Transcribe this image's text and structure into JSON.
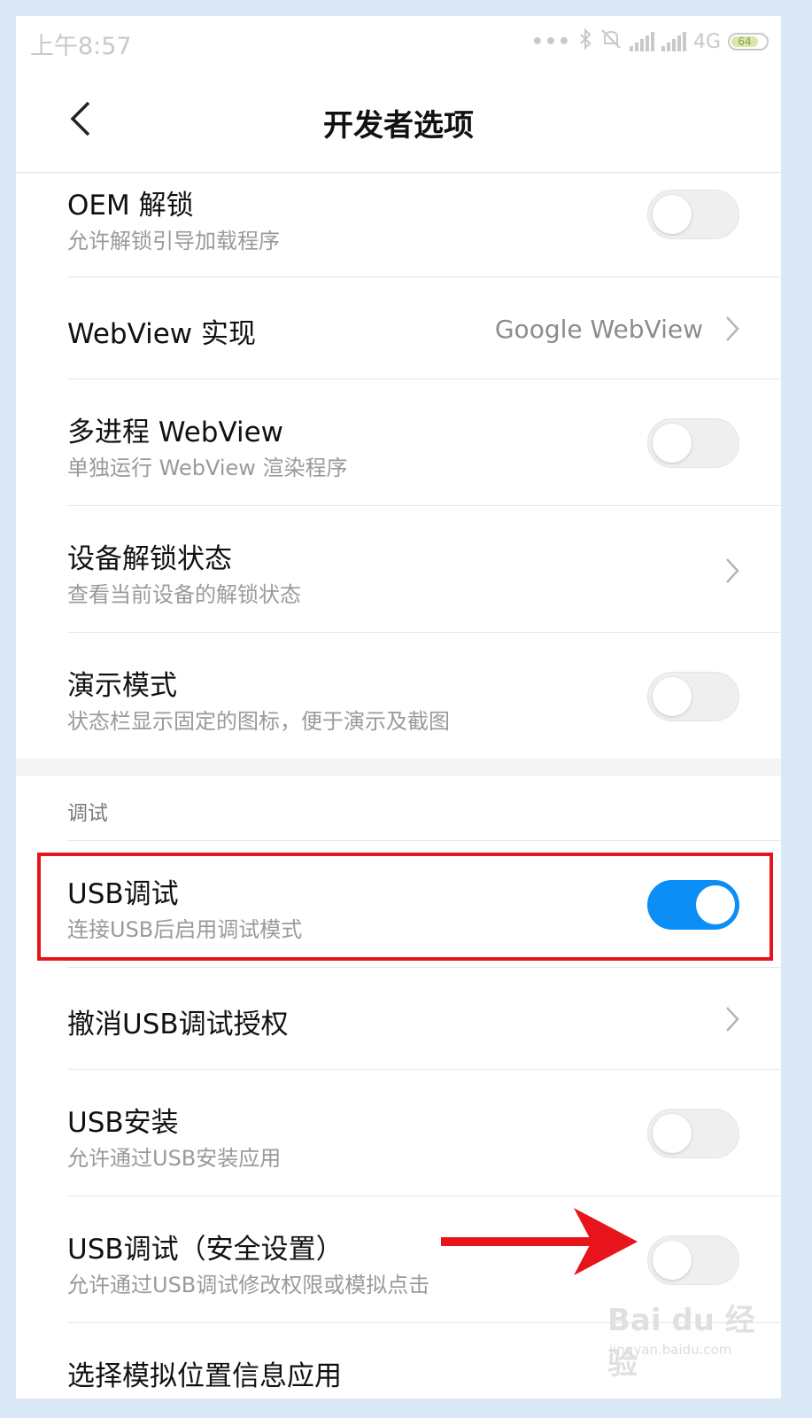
{
  "status": {
    "time": "上午8:57",
    "network": "4G",
    "battery": "64"
  },
  "header": {
    "title": "开发者选项"
  },
  "items": [
    {
      "title": "OEM 解锁",
      "subtitle": "允许解锁引导加载程序",
      "type": "toggle",
      "on": false
    },
    {
      "title": "WebView 实现",
      "value": "Google WebView",
      "type": "nav"
    },
    {
      "title": "多进程 WebView",
      "subtitle": "单独运行 WebView 渲染程序",
      "type": "toggle",
      "on": false
    },
    {
      "title": "设备解锁状态",
      "subtitle": "查看当前设备的解锁状态",
      "type": "nav"
    },
    {
      "title": "演示模式",
      "subtitle": "状态栏显示固定的图标，便于演示及截图",
      "type": "toggle",
      "on": false
    }
  ],
  "debug_section": {
    "label": "调试",
    "items": [
      {
        "title": "USB调试",
        "subtitle": "连接USB后启用调试模式",
        "type": "toggle",
        "on": true
      },
      {
        "title": "撤消USB调试授权",
        "type": "nav"
      },
      {
        "title": "USB安装",
        "subtitle": "允许通过USB安装应用",
        "type": "toggle",
        "on": false
      },
      {
        "title": "USB调试（安全设置）",
        "subtitle": "允许通过USB调试修改权限或模拟点击",
        "type": "toggle",
        "on": false
      },
      {
        "title": "选择模拟位置信息应用",
        "type": "nav"
      }
    ]
  },
  "colors": {
    "accent": "#0b8ef5",
    "highlight": "#e8141b"
  },
  "watermark": {
    "brand": "Bai du 经验",
    "url": "jingyan.baidu.com"
  }
}
